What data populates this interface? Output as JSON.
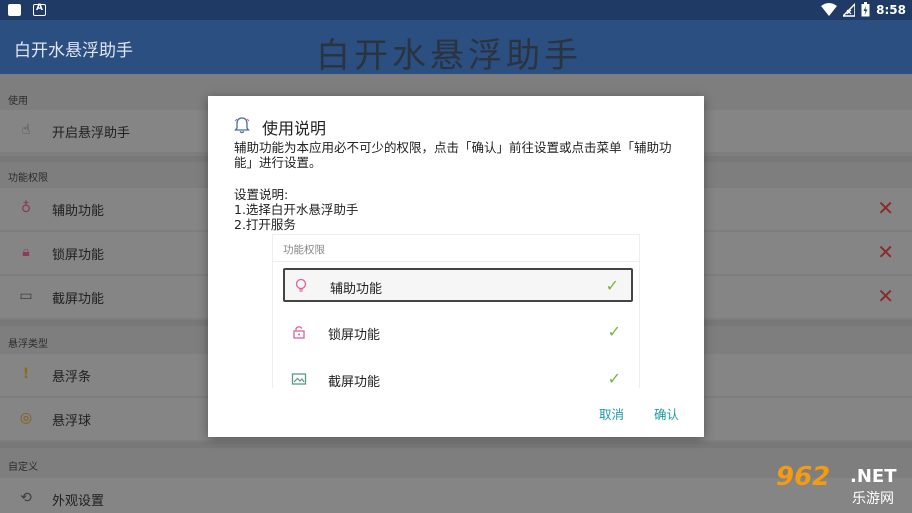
{
  "status_bar": {
    "time": "8:58",
    "left_icons": [
      "square-icon",
      "a-box-icon"
    ],
    "right_icons": [
      "wifi-icon",
      "signal-icon",
      "battery-icon"
    ]
  },
  "app_bar": {
    "title": "白开水悬浮助手",
    "logo_text": "白开水悬浮助手"
  },
  "background_list": {
    "sections": [
      {
        "header": "使用",
        "items": [
          {
            "label": "开启悬浮助手",
            "icon": "hand-pointer-icon"
          }
        ]
      },
      {
        "header": "功能权限",
        "items": [
          {
            "label": "辅助功能",
            "icon": "bulb-icon",
            "status": "✕"
          },
          {
            "label": "锁屏功能",
            "icon": "lock-icon",
            "status": "✕"
          },
          {
            "label": "截屏功能",
            "icon": "image-icon",
            "status": "✕"
          }
        ]
      },
      {
        "header": "悬浮类型",
        "items": [
          {
            "label": "悬浮条",
            "icon": "exclamation-icon"
          },
          {
            "label": "悬浮球",
            "icon": "ring-icon"
          }
        ]
      },
      {
        "header": "自定义",
        "items": [
          {
            "label": "外观设置",
            "icon": "settings-icon"
          }
        ]
      }
    ]
  },
  "dialog": {
    "title": "使用说明",
    "message": "辅助功能为本应用必不可少的权限，点击「确认」前往设置或点击菜单「辅助功能」进行设置。",
    "instructions": [
      "设置说明:",
      "1.选择白开水悬浮助手",
      "2.打开服务"
    ],
    "preview": {
      "header": "功能权限",
      "rows": [
        {
          "label": "辅助功能",
          "check": "✓",
          "icon": "bulb-icon"
        },
        {
          "label": "锁屏功能",
          "check": "✓",
          "icon": "lock-icon"
        },
        {
          "label": "截屏功能",
          "check": "✓",
          "icon": "image-icon"
        }
      ]
    },
    "cancel_label": "取消",
    "confirm_label": "确认"
  },
  "watermark": {
    "number": "962",
    "net": ".NET",
    "cn": "乐游网"
  },
  "colors": {
    "status_bar": "#1f3a64",
    "app_bar": "#2b4f80",
    "dialog_button": "#1e9aa6",
    "check": "#7cb342",
    "error_x": "#8b2a2a",
    "icon_pink": "#e0609a"
  }
}
